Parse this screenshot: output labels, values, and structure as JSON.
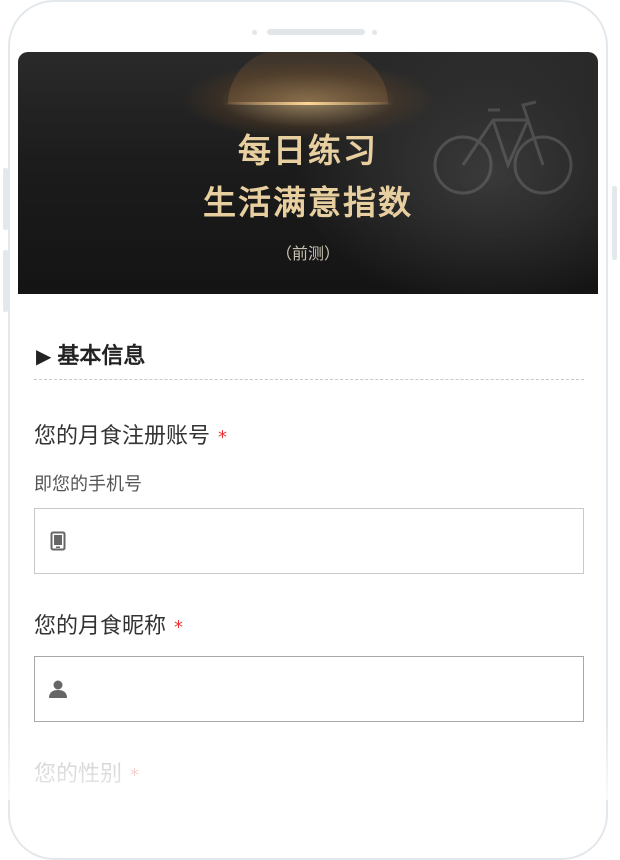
{
  "banner": {
    "title_line1": "每日练习",
    "title_line2": "生活满意指数",
    "subtitle": "（前测）"
  },
  "form": {
    "section_title": "基本信息",
    "fields": [
      {
        "label": "您的月食注册账号",
        "required_mark": "*",
        "hint": "即您的手机号",
        "icon": "mobile-phone-icon",
        "value": ""
      },
      {
        "label": "您的月食昵称",
        "required_mark": "*",
        "icon": "user-icon",
        "value": ""
      },
      {
        "label": "您的性别",
        "required_mark": "*"
      }
    ]
  },
  "colors": {
    "banner_text": "#e8cfa0",
    "required": "#e33333",
    "input_border": "#c9c9c9"
  }
}
